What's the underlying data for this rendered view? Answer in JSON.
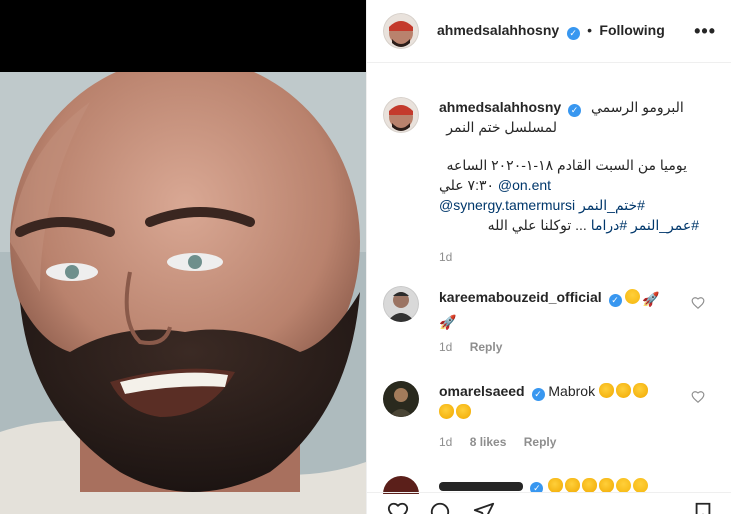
{
  "post": {
    "author": "ahmedsalahhosny",
    "follow_separator": "•",
    "follow_status": "Following",
    "more_label": "•••",
    "caption_line1": "البرومو الرسمي",
    "caption_line2": "لمسلسل ختم النمر",
    "caption_line3": "يوميا من السبت القادم ١٨-١-٢٠٢٠ الساعه",
    "caption_line4_text": "٧:٣٠ علي",
    "caption_line4_link": "@on.ent",
    "caption_line5_mention": "@synergy.tamermursi",
    "caption_line5_hashtag": "#ختم_النمر",
    "caption_line6_hashtag1": "#عمر_النمر",
    "caption_line6_hashtag2": "#دراما",
    "caption_line6_text": "... توكلنا علي الله",
    "time": "1d"
  },
  "comments": [
    {
      "author": "kareemabouzeid_official",
      "time": "1d",
      "reply_label": "Reply",
      "emojis": [
        "heart-eyes",
        "rocket",
        "rocket"
      ]
    },
    {
      "author": "omarelsaeed",
      "text": "Mabrok",
      "time": "1d",
      "likes": "8 likes",
      "reply_label": "Reply",
      "emojis": [
        "clap",
        "clap",
        "clap",
        "clap",
        "clap"
      ]
    }
  ],
  "colors": {
    "verified": "#3897f0",
    "link": "#00376b",
    "muted": "#8e8e8e",
    "text": "#262626",
    "border": "#efefef"
  },
  "icons": [
    "verified-badge-icon",
    "more-options-icon",
    "heart-icon",
    "comment-icon",
    "share-icon",
    "save-icon"
  ]
}
